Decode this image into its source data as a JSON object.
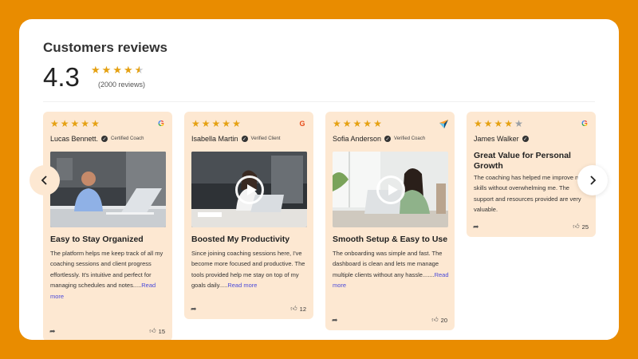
{
  "colors": {
    "frame": "#E98C00",
    "panel": "#FFFFFF",
    "card": "#FDE8D2",
    "star": "#E5A112",
    "link": "#4A4AD9"
  },
  "header": {
    "title": "Customers reviews",
    "rating": "4.3",
    "rating_value": 4.3,
    "max_rating": 5,
    "count_text": "(2000 reviews)"
  },
  "reviews": [
    {
      "name": "Lucas Bennett.",
      "badge": "Certified Coach",
      "stars": 5,
      "source_icon": "google-icon",
      "title": "Easy to Stay Organized",
      "body": "The platform helps me keep track of all my coaching sessions and client progress effortlessly. It's intuitive and perfect for managing schedules and notes.....",
      "read_more": "Read more",
      "likes": "15",
      "video": false
    },
    {
      "name": "Isabella Martin",
      "badge": "Verified Client",
      "stars": 5,
      "source_icon": "g2-icon",
      "title": "Boosted My Productivity",
      "body": "Since joining coaching sessions here, I've become more focused and productive. The tools provided help me stay on top of my goals daily.....",
      "read_more": "Read more",
      "likes": "12",
      "video": true
    },
    {
      "name": "Sofia Anderson",
      "badge": "Verified Coach",
      "stars": 5,
      "source_icon": "capterra-icon",
      "title": "Smooth Setup & Easy to Use",
      "body": "The onboarding was simple and fast. The dashboard is clean and lets me manage multiple clients without any hassle.......",
      "read_more": "Read more",
      "likes": "20",
      "video": true
    },
    {
      "name": "James Walker",
      "badge": "",
      "stars": 4,
      "source_icon": "google-icon",
      "title": "Great Value for Personal Growth",
      "body": "The coaching has helped me improve my skills without overwhelming me. The support and resources provided are very valuable.",
      "read_more": "",
      "likes": "25",
      "video": false
    }
  ],
  "nav": {
    "prev_icon": "chevron-left-icon",
    "next_icon": "chevron-right-icon"
  }
}
